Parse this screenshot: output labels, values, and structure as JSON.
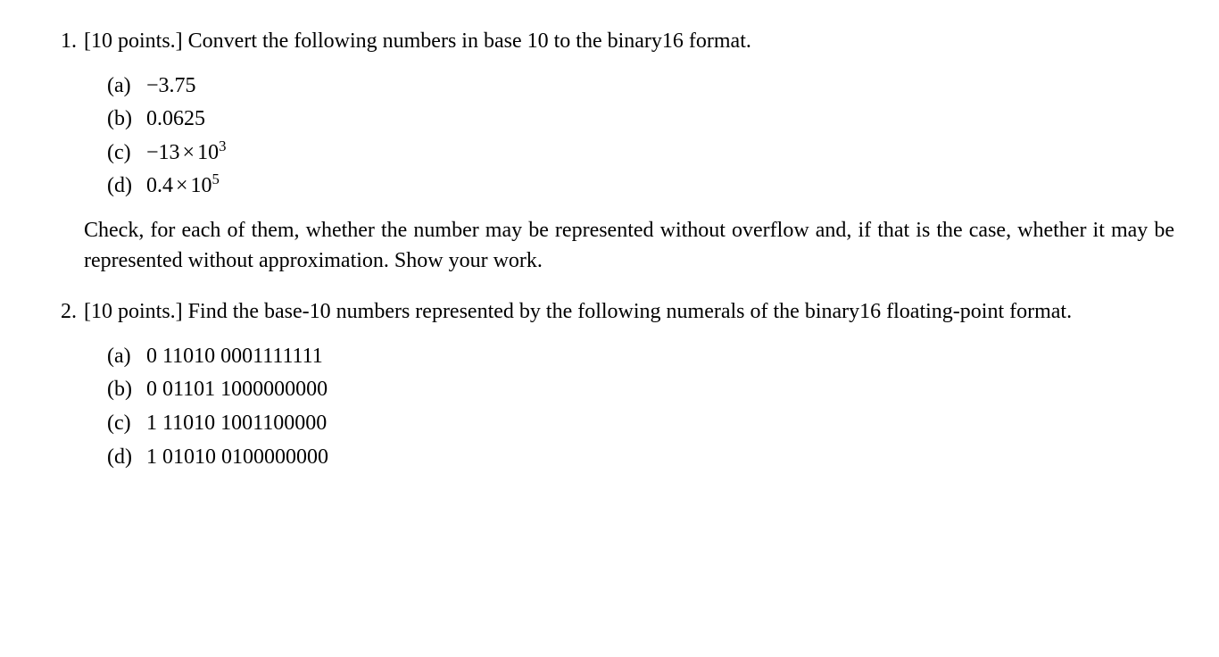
{
  "questions": [
    {
      "number": "1.",
      "points": "[10 points.]",
      "prompt": "Convert the following numbers in base 10 to the binary16 format.",
      "items": [
        {
          "label": "(a)",
          "value": "−3.75"
        },
        {
          "label": "(b)",
          "value": "0.0625"
        },
        {
          "label": "(c)",
          "prefix": "−13",
          "times": "×",
          "base": "10",
          "exp": "3"
        },
        {
          "label": "(d)",
          "prefix": "0.4",
          "times": "×",
          "base": "10",
          "exp": "5"
        }
      ],
      "followup": "Check, for each of them, whether the number may be represented without overflow and, if that is the case, whether it may be represented without approximation. Show your work."
    },
    {
      "number": "2.",
      "points": "[10 points.]",
      "prompt": "Find the base-10 numbers represented by the following numerals of the binary16 floating-point format.",
      "items": [
        {
          "label": "(a)",
          "value": "0 11010 0001111111"
        },
        {
          "label": "(b)",
          "value": "0 01101 1000000000"
        },
        {
          "label": "(c)",
          "value": "1 11010 1001100000"
        },
        {
          "label": "(d)",
          "value": "1 01010 0100000000"
        }
      ]
    }
  ]
}
